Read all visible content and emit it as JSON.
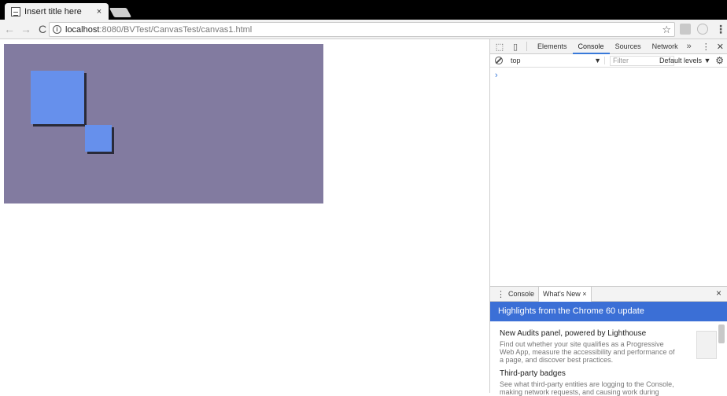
{
  "browser": {
    "tab_title": "Insert title here",
    "tab_close": "×",
    "url_host": "localhost",
    "url_rest": ":8080/BVTest/CanvasTest/canvas1.html",
    "back_icon": "←",
    "forward_icon": "→",
    "reload_icon": "C",
    "star_icon": "☆",
    "menu_icon": "⋮"
  },
  "canvas": {
    "background": "#827ba0",
    "square_color": "#6690ec",
    "shadow_color": "#2a2a38"
  },
  "devtools": {
    "tabs": [
      "Elements",
      "Console",
      "Sources",
      "Network"
    ],
    "active_tab": "Console",
    "more": "»",
    "context": "top",
    "context_arrow": "▼",
    "filter_placeholder": "Filter",
    "levels": "Default levels ▼",
    "settings_icon": "⚙",
    "prompt": "›",
    "drawer": {
      "tabs": [
        "Console",
        "What's New"
      ],
      "close_tab": "×",
      "close": "×",
      "banner": "Highlights from the Chrome 60 update",
      "items": [
        {
          "title": "New Audits panel, powered by Lighthouse",
          "desc": "Find out whether your site qualifies as a Progressive Web App, measure the accessibility and performance of a page, and discover best practices."
        },
        {
          "title": "Third-party badges",
          "desc": "See what third-party entities are logging to the Console, making network requests, and causing work during"
        }
      ]
    }
  }
}
